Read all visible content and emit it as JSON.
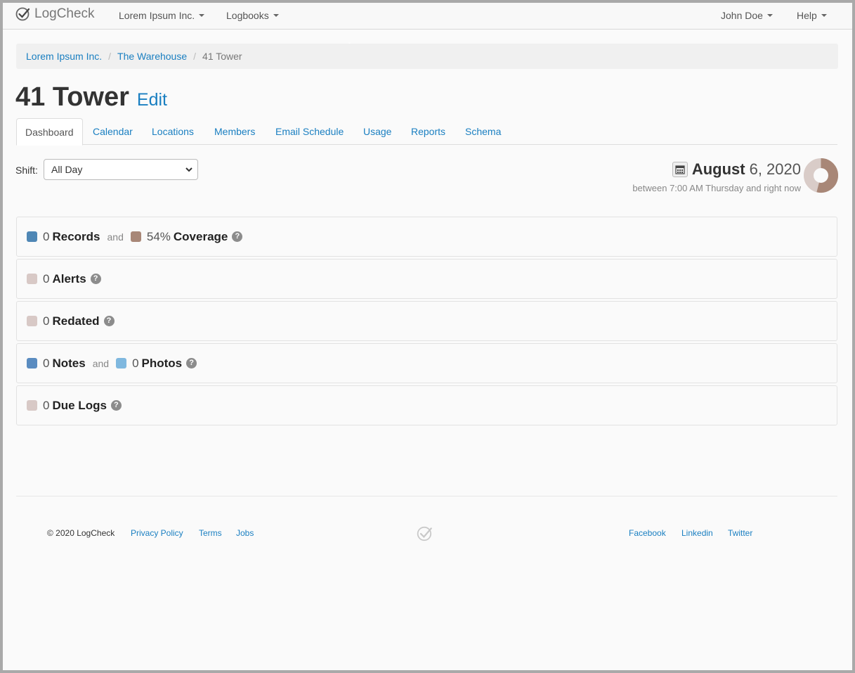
{
  "navbar": {
    "brand": "LogCheck",
    "org_menu": "Lorem Ipsum Inc.",
    "logbooks_menu": "Logbooks",
    "user_menu": "John Doe",
    "help_menu": "Help"
  },
  "breadcrumb": {
    "items": [
      "Lorem Ipsum Inc.",
      "The Warehouse",
      "41 Tower"
    ]
  },
  "page": {
    "title": "41 Tower",
    "edit_label": "Edit"
  },
  "tabs": [
    "Dashboard",
    "Calendar",
    "Locations",
    "Members",
    "Email Schedule",
    "Usage",
    "Reports",
    "Schema"
  ],
  "shift": {
    "label": "Shift:",
    "selected": "All Day"
  },
  "date": {
    "month": "August",
    "rest": "6, 2020",
    "subtitle": "between 7:00 AM Thursday and right now",
    "coverage_fraction": 0.54
  },
  "panels": {
    "records": {
      "count": "0",
      "label": "Records",
      "and": "and",
      "coverage_value": "54%",
      "coverage_label": "Coverage"
    },
    "alerts": {
      "count": "0",
      "label": "Alerts"
    },
    "redated": {
      "count": "0",
      "label": "Redated"
    },
    "notes": {
      "count": "0",
      "label": "Notes",
      "and": "and",
      "photos_count": "0",
      "photos_label": "Photos"
    },
    "due_logs": {
      "count": "0",
      "label": "Due Logs"
    }
  },
  "colors": {
    "link": "#1a7fc1",
    "records_swatch": "#4f87b5",
    "coverage_swatch": "#a88777",
    "neutral_swatch": "#d8c9c6",
    "notes_swatch": "#5a8cc0",
    "photos_swatch": "#7fb8df"
  },
  "footer": {
    "copyright": "© 2020 LogCheck",
    "privacy": "Privacy Policy",
    "terms": "Terms",
    "jobs": "Jobs",
    "facebook": "Facebook",
    "linkedin": "Linkedin",
    "twitter": "Twitter"
  }
}
